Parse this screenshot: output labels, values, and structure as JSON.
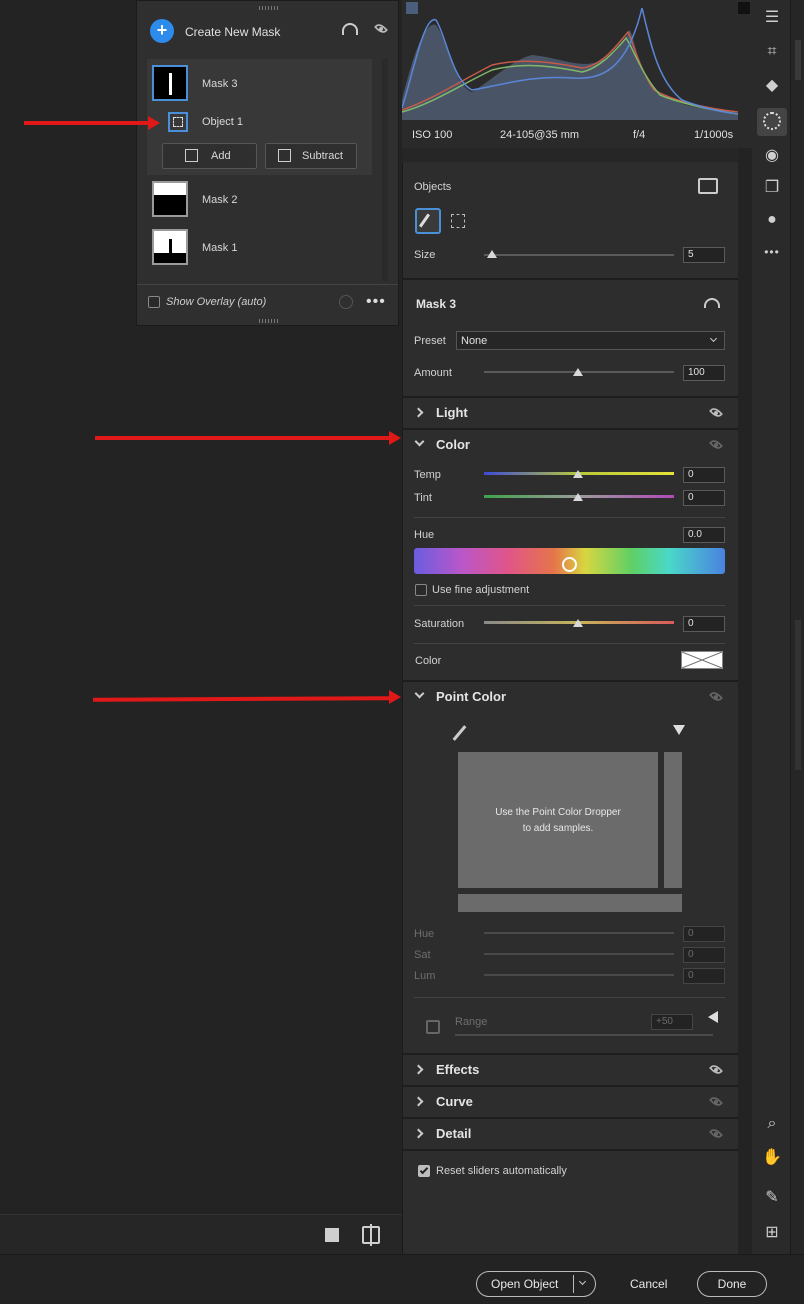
{
  "mask_panel": {
    "create_label": "Create New Mask",
    "masks": [
      {
        "label": "Mask 3"
      },
      {
        "label": "Mask 2"
      },
      {
        "label": "Mask 1"
      }
    ],
    "sub_item": "Object 1",
    "add_label": "Add",
    "subtract_label": "Subtract",
    "overlay_label": "Show Overlay (auto)",
    "overlay_checked": false
  },
  "histogram": {
    "iso": "ISO 100",
    "lens": "24-105@35 mm",
    "aperture": "f/4",
    "shutter": "1/1000s"
  },
  "objects": {
    "title": "Objects",
    "size_label": "Size",
    "size_value": "5"
  },
  "mask": {
    "title": "Mask 3",
    "preset_label": "Preset",
    "preset_value": "None",
    "amount_label": "Amount",
    "amount_value": "100"
  },
  "sections": {
    "light": "Light",
    "color": "Color",
    "point_color": "Point Color",
    "effects": "Effects",
    "curve": "Curve",
    "detail": "Detail"
  },
  "color": {
    "temp_label": "Temp",
    "temp_value": "0",
    "tint_label": "Tint",
    "tint_value": "0",
    "hue_label": "Hue",
    "hue_value": "0.0",
    "fine_label": "Use fine adjustment",
    "fine_checked": false,
    "saturation_label": "Saturation",
    "saturation_value": "0",
    "color_label": "Color"
  },
  "point_color": {
    "hint_line1": "Use the Point Color Dropper",
    "hint_line2": "to add samples.",
    "hue_label": "Hue",
    "hue_value": "0",
    "sat_label": "Sat",
    "sat_value": "0",
    "lum_label": "Lum",
    "lum_value": "0",
    "range_label": "Range",
    "range_value": "+50"
  },
  "reset_label": "Reset sliders automatically",
  "reset_checked": true,
  "footer": {
    "open_object": "Open Object",
    "cancel": "Cancel",
    "done": "Done"
  },
  "colors": {
    "accent": "#2d8ceb",
    "annotation": "#e11818",
    "panel": "#2d2d2d"
  }
}
